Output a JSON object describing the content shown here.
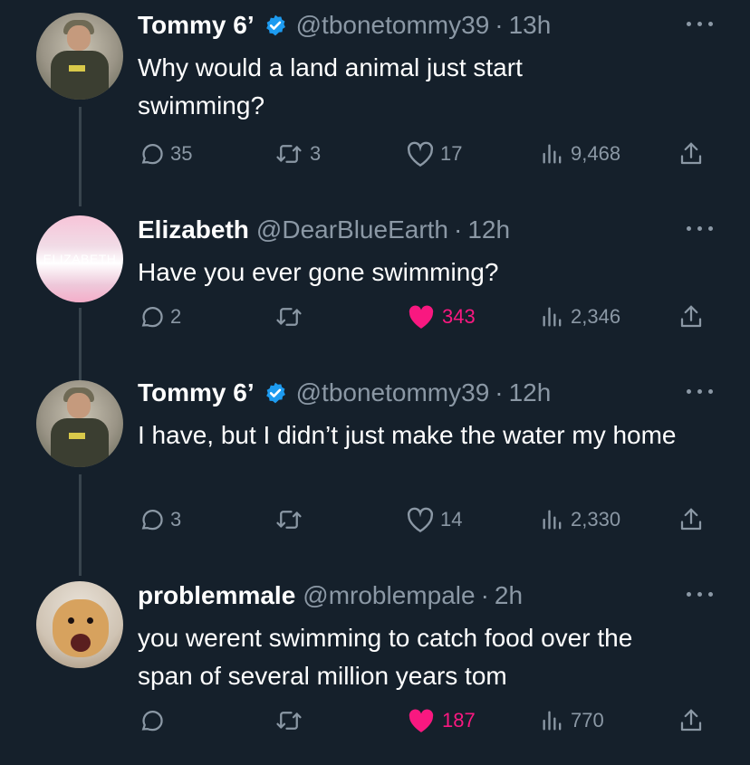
{
  "tweets": [
    {
      "name": "Tommy 6’",
      "verified": true,
      "handle": "@tbonetommy39",
      "time": "13h",
      "text": "Why would a land animal just start swimming?",
      "avatar_icon": "soldier-avatar",
      "replies": "35",
      "retweets": "3",
      "likes": "17",
      "views": "9,468",
      "liked": false
    },
    {
      "name": "Elizabeth",
      "verified": false,
      "handle": "@DearBlueEarth",
      "time": "12h",
      "text": "Have you ever gone swimming?",
      "avatar_text": "ELIZABETH",
      "replies": "2",
      "retweets": "",
      "likes": "343",
      "views": "2,346",
      "liked": true
    },
    {
      "name": "Tommy 6’",
      "verified": true,
      "handle": "@tbonetommy39",
      "time": "12h",
      "text": "I have, but I didn’t just make the water my home",
      "avatar_icon": "soldier-avatar",
      "replies": "3",
      "retweets": "",
      "likes": "14",
      "views": "2,330",
      "liked": false
    },
    {
      "name": "problemmale",
      "verified": false,
      "handle": "@mroblempale",
      "time": "2h",
      "text": "you werent swimming to catch food over the span of several million years tom",
      "avatar_icon": "dog-avatar",
      "replies": "",
      "retweets": "",
      "likes": "187",
      "views": "770",
      "liked": true
    }
  ],
  "separator": "·",
  "colors": {
    "background": "#15202b",
    "muted": "#8b98a5",
    "like": "#f91880",
    "verified": "#1d9bf0"
  }
}
